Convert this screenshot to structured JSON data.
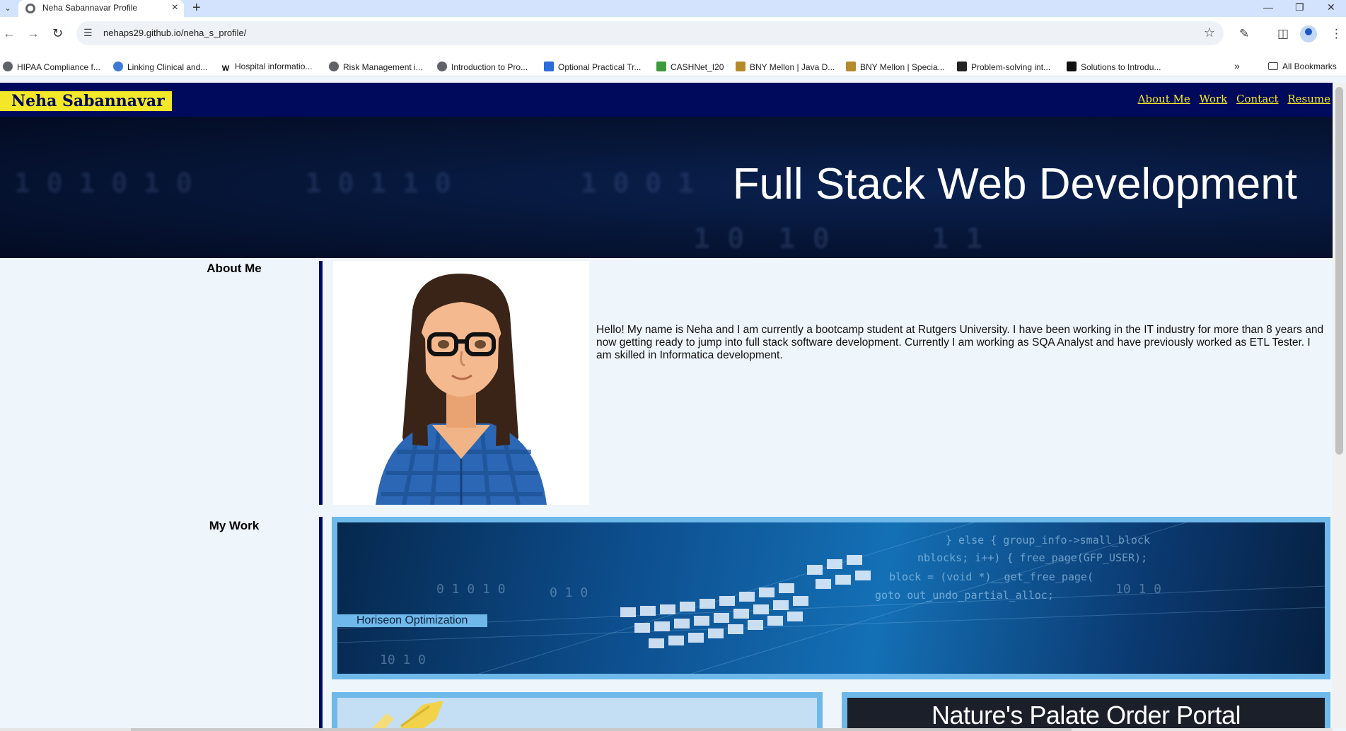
{
  "browser": {
    "tab_title": "Neha Sabannavar Profile",
    "url": "nehaps29.github.io/neha_s_profile/",
    "bookmarks": [
      "HIPAA Compliance f...",
      "Linking Clinical and...",
      "Hospital informatio...",
      "Risk Management i...",
      "Introduction to Pro...",
      "Optional Practical Tr...",
      "CASHNet_I20",
      "BNY Mellon | Java D...",
      "BNY Mellon | Specia...",
      "Problem-solving int...",
      "Solutions to Introdu..."
    ],
    "all_bookmarks": "All Bookmarks",
    "icons": [
      "tab-search-icon",
      "favicon-globe-icon",
      "close-tab-icon",
      "new-tab-icon",
      "back-icon",
      "forward-icon",
      "reload-icon",
      "site-settings-icon",
      "bookmark-star-icon",
      "extensions-icon",
      "side-panel-icon",
      "profile-icon",
      "menu-icon"
    ]
  },
  "header": {
    "brand": "Neha Sabannavar",
    "nav": [
      "About Me",
      "Work",
      "Contact",
      "Resume"
    ],
    "colors": {
      "bar": "#000a5c",
      "accent": "#f2e829"
    }
  },
  "hero": {
    "title": "Full Stack Web Development"
  },
  "about": {
    "label": "About Me",
    "text": "Hello! My name is Neha and I am currently a bootcamp student at Rutgers University. I have been working in the IT industry for more than 8 years and now getting ready to jump into full stack software development. Currently I am working as SQA Analyst and have previously worked as ETL Tester. I am skilled in Informatica development."
  },
  "work": {
    "label": "My Work",
    "projects": [
      {
        "title": "Horiseon Optimization"
      },
      {
        "title": ""
      },
      {
        "title": "Nature's Palate Order Portal"
      }
    ]
  }
}
